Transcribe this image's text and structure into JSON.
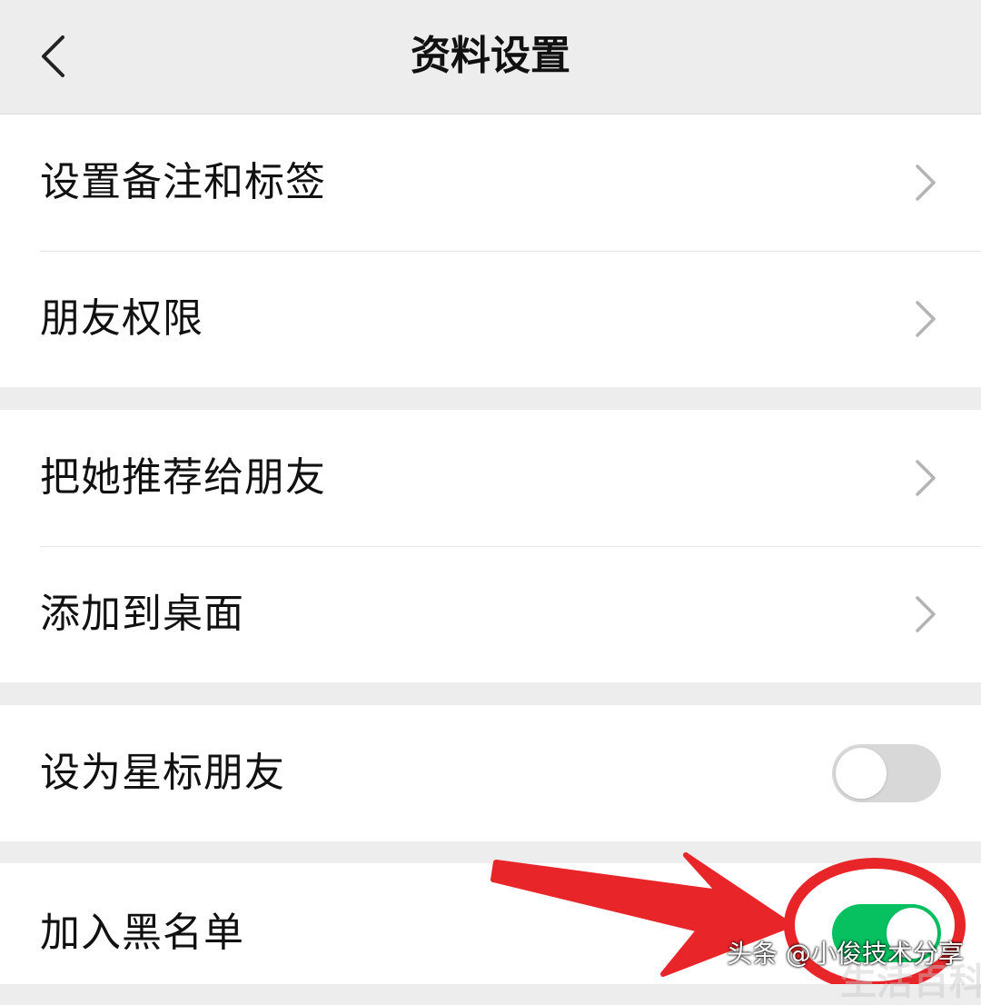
{
  "header": {
    "title": "资料设置",
    "back_icon": "chevron-left-icon"
  },
  "groups": [
    {
      "items": [
        {
          "label": "设置备注和标签",
          "control": "chevron"
        },
        {
          "label": "朋友权限",
          "control": "chevron"
        }
      ]
    },
    {
      "items": [
        {
          "label": "把她推荐给朋友",
          "control": "chevron"
        },
        {
          "label": "添加到桌面",
          "control": "chevron"
        }
      ]
    },
    {
      "items": [
        {
          "label": "设为星标朋友",
          "control": "toggle",
          "on": false
        }
      ]
    },
    {
      "items": [
        {
          "label": "加入黑名单",
          "control": "toggle",
          "on": true
        }
      ]
    }
  ],
  "watermark": {
    "text": "头条 @小俊技术分享",
    "faint_text": "生活百科"
  },
  "colors": {
    "background": "#ededed",
    "toggle_on": "#07c160",
    "toggle_off": "#d8d8d8",
    "annotation": "#e8262a"
  }
}
